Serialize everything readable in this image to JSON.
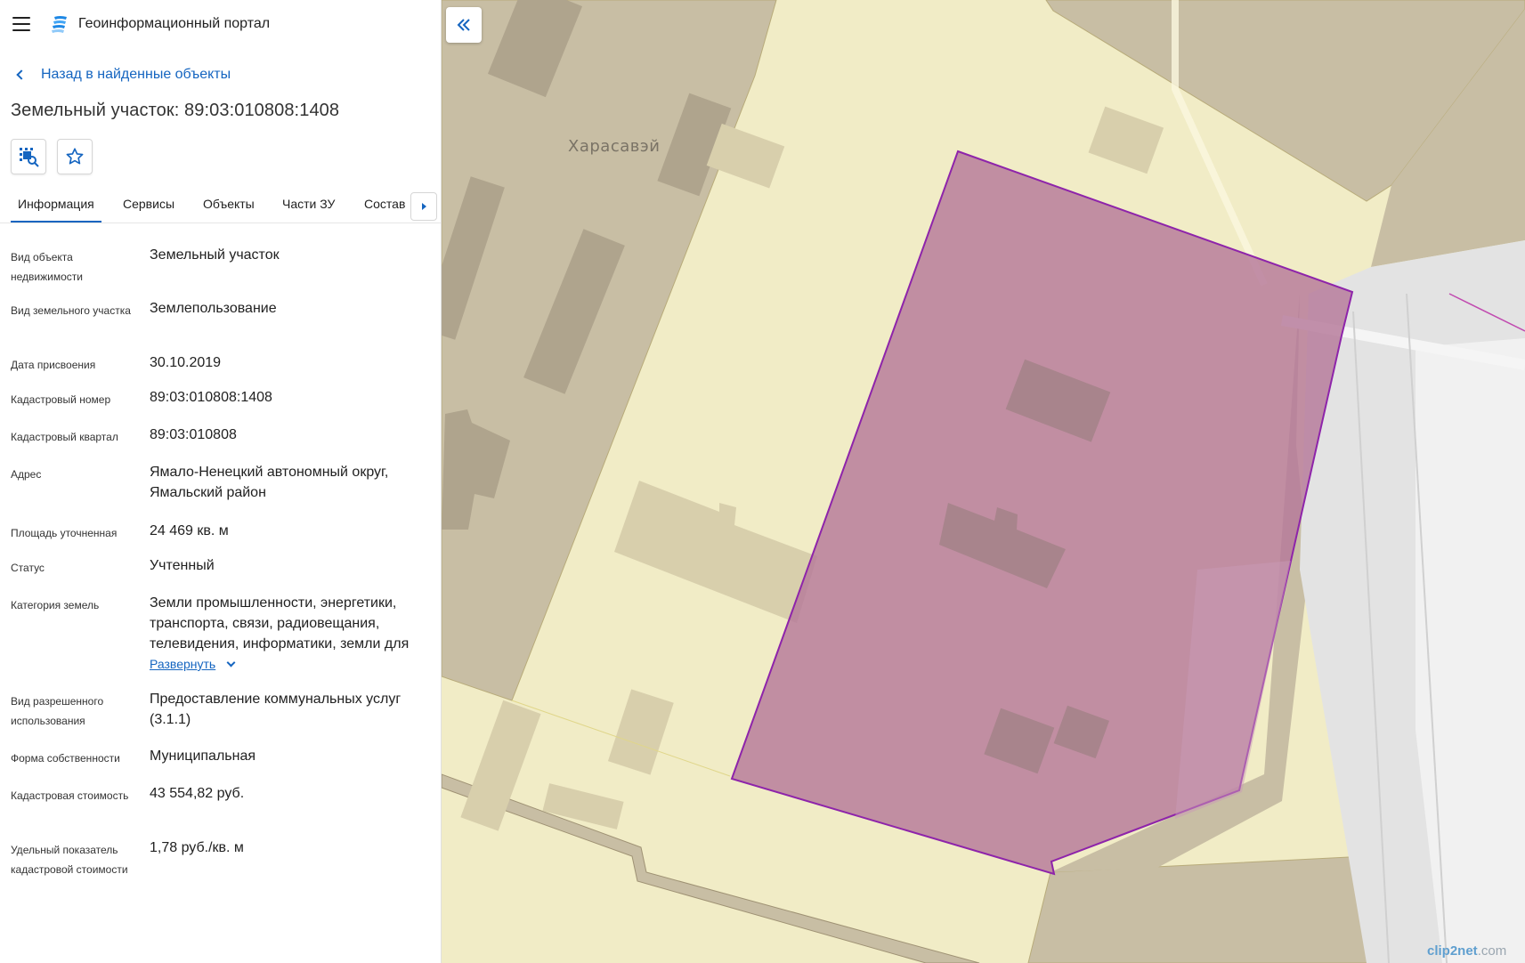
{
  "header": {
    "app_title": "Геоинформационный портал",
    "menu_icon": "hamburger-menu-icon",
    "logo_icon": "portal-logo-icon"
  },
  "nav": {
    "back_label": "Назад в найденные объекты"
  },
  "object": {
    "title": "Земельный участок: 89:03:010808:1408"
  },
  "toolbar": {
    "locate_icon": "map-locate-icon",
    "favorite_icon": "star-icon"
  },
  "tabs": [
    {
      "label": "Информация",
      "active": true
    },
    {
      "label": "Сервисы",
      "active": false
    },
    {
      "label": "Объекты",
      "active": false
    },
    {
      "label": "Части ЗУ",
      "active": false
    },
    {
      "label": "Состав",
      "active": false
    }
  ],
  "details": [
    {
      "label": "Вид объекта недвижимости",
      "value": "Земельный участок"
    },
    {
      "label": "Вид земельного участка",
      "value": "Землепользование"
    },
    {
      "label": "Дата присвоения",
      "value": "30.10.2019"
    },
    {
      "label": "Кадастровый номер",
      "value": "89:03:010808:1408"
    },
    {
      "label": "Кадастровый квартал",
      "value": "89:03:010808"
    },
    {
      "label": "Адрес",
      "value": "Ямало-Ненецкий автономный округ, Ямальский район"
    },
    {
      "label": "Площадь уточненная",
      "value": "24 469 кв. м"
    },
    {
      "label": "Статус",
      "value": "Учтенный"
    },
    {
      "label": "Категория земель",
      "value": "Земли промышленности, энергетики, транспорта, связи, радиовещания, телевидения, информатики, земли для"
    },
    {
      "label": "Вид разрешенного использования",
      "value": "Предоставление коммунальных услуг (3.1.1)"
    },
    {
      "label": "Форма собственности",
      "value": "Муниципальная"
    },
    {
      "label": "Кадастровая стоимость",
      "value": "43 554,82 руб."
    },
    {
      "label": "Удельный показатель кадастровой стоимости",
      "value": "1,78 руб./кв. м"
    }
  ],
  "expand_label": "Развернуть",
  "map": {
    "place_label": "Харасавэй",
    "collapse_icon": "double-chevron-left-icon",
    "watermark_brand": "clip2net",
    "watermark_domain": ".com",
    "colors": {
      "land": "#f1ecc6",
      "zone": "#c8bea4",
      "building": "#afa48d",
      "parcel_fill": "#b6799a",
      "parcel_stroke": "#8e24aa",
      "road": "#e3e3e3"
    }
  }
}
